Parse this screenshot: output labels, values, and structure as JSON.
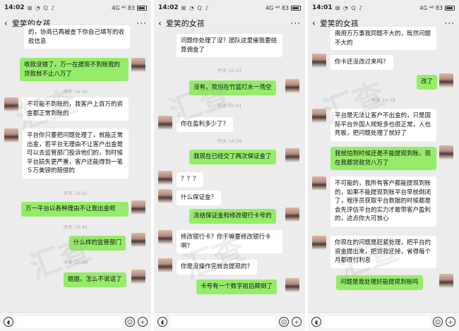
{
  "panels": [
    {
      "status": {
        "time": "14:02",
        "icons": "⊠ ◔ Q ♪",
        "right": "4G ⁴⁶ 83"
      },
      "title": "爱笑的女孩",
      "messages": [
        {
          "side": "recv",
          "text": "的，协商已再被查下你自己填写的收款信息"
        },
        {
          "side": "sent",
          "text": "收款没错了，万一在提现不到账我的贷款就不止八万了"
        },
        {
          "ts": "昨天 16:39"
        },
        {
          "side": "recv",
          "text": "不可能不到账的，我客户上百万的资金都正常到账的"
        },
        {
          "side": "recv",
          "text": "平台你只要把问题处理了，就能正常出金，若平台无理由不让客户出金是可以去监管部门投诉他们的，到时候平台损失更严重，客户还能得到一笔５万美镑的赔偿的"
        },
        {
          "ts": "昨天 16:42"
        },
        {
          "side": "sent",
          "text": "万一平台以各种理由不让我出金呢"
        },
        {
          "ts": "昨天 16:45"
        },
        {
          "side": "sent",
          "text": "什么样的监管部门"
        },
        {
          "ts": "昨天 17:38"
        },
        {
          "side": "sent",
          "text": "姐姐，怎么不说话了"
        }
      ]
    },
    {
      "status": {
        "time": "14:02",
        "icons": "⊠ ◔ Q ♪",
        "right": "4G ⁴⁶ 83"
      },
      "title": "爱笑的女孩",
      "messages": [
        {
          "side": "recv",
          "text": "问题你处理了没？团队这里催我要结算佣金了"
        },
        {
          "ts": "昨天 15:53"
        },
        {
          "side": "sent",
          "text": "没有，我怕在竹篮打水一场空"
        },
        {
          "ts": "昨天 15:54"
        },
        {
          "side": "recv",
          "text": "你在盈利多少了？"
        },
        {
          "ts": "昨天 16:58"
        },
        {
          "side": "sent",
          "text": "我现在已经交了两次保证金了"
        },
        {
          "side": "recv",
          "text": "？？？"
        },
        {
          "side": "recv",
          "text": "什么保证金？"
        },
        {
          "side": "sent",
          "text": "冻结保证金和修改银行卡号的"
        },
        {
          "side": "recv",
          "text": "修改银行卡？你干嘛要修改银行卡啊？"
        },
        {
          "side": "recv",
          "text": "你是没操作完就去提现的？"
        },
        {
          "side": "sent",
          "text": "卡号有一个数字前后颠倒了"
        }
      ]
    },
    {
      "status": {
        "time": "14:01",
        "icons": "⊠ ◔ Q ♪",
        "right": "4G ⁴⁶ 83"
      },
      "title": "爱笑的女孩",
      "messages": [
        {
          "side": "recv",
          "text": "南用万万事我同题不大的，既然问题不大的"
        },
        {
          "side": "recv",
          "text": "你卡还没改过来吗？"
        },
        {
          "side": "sent",
          "text": "改了"
        },
        {
          "ts": "昨天 16:38"
        },
        {
          "side": "recv",
          "text": "平台是无法让客户不出金的，只是国际平台外国人规矩多也很正常，人也死板，把问题处理了就好了"
        },
        {
          "side": "sent",
          "text": "我就怕到时候还是不能提现到账，现在我都贷款贷八万了"
        },
        {
          "side": "recv",
          "text": "不可能的，我所有客户都能提现到账的，如果不能提现到账平台早就倒闭了，程序员获取平台数据的时候都是会先评估平台的实力才敢带客户盈利的，这点你大可放心"
        },
        {
          "side": "recv",
          "text": "你现在的问题是赶紧处理，把平台的资金提出来，把贷款还掉，省得每个月都得付利息"
        },
        {
          "side": "sent",
          "text": "问题是我处理好能提现到账吗"
        }
      ]
    }
  ],
  "watermark": "汇查"
}
